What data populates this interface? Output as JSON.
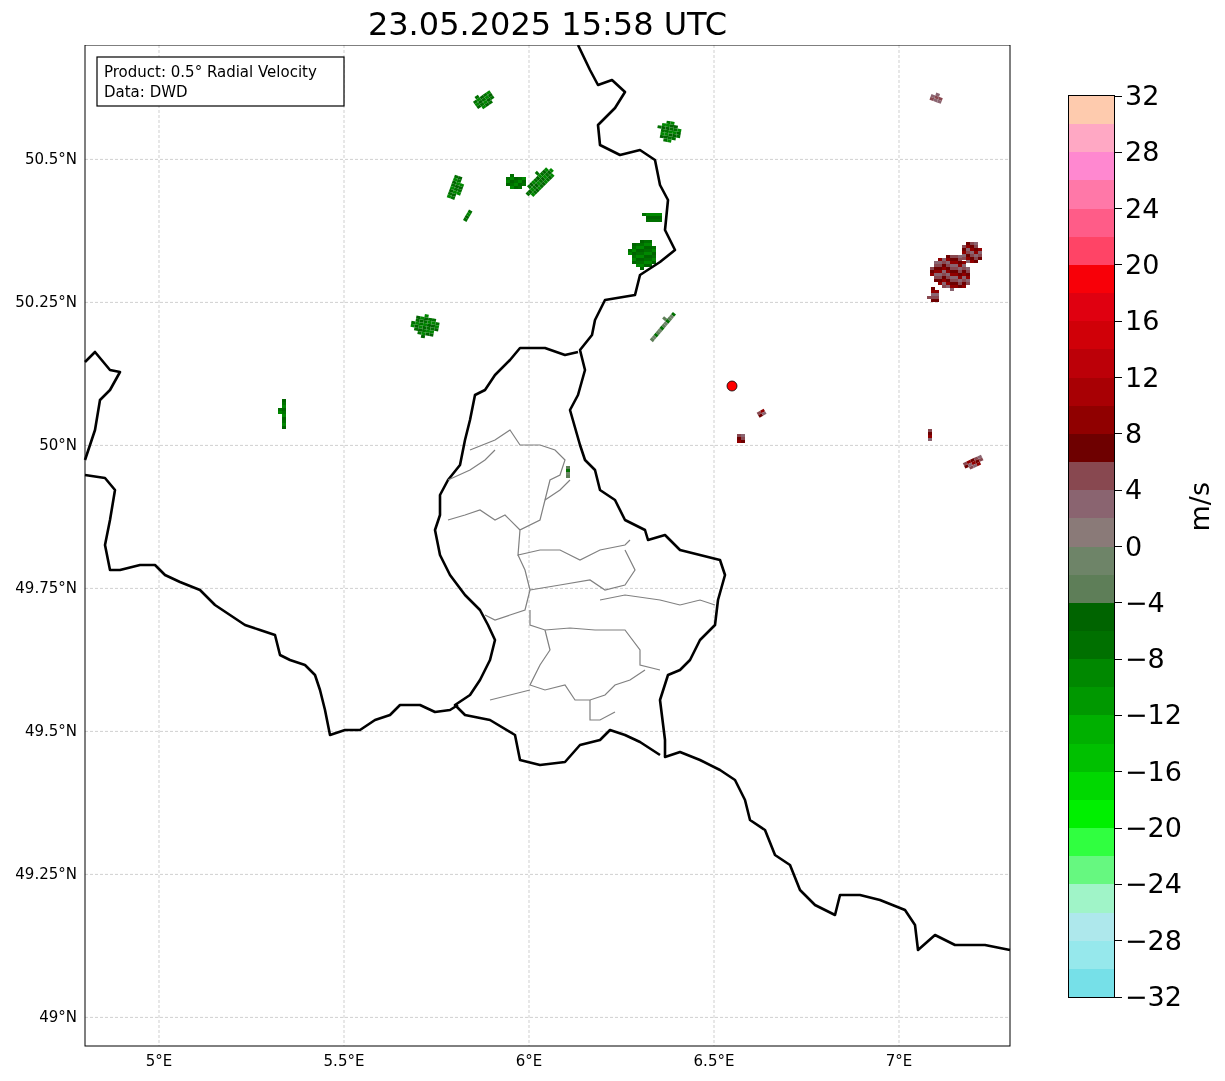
{
  "title": "23.05.2025 15:58 UTC",
  "map": {
    "yticks": [
      "50.5°N",
      "50.25°N",
      "50°N",
      "49.75°N",
      "49.5°N",
      "49.25°N",
      "49°N"
    ],
    "xticks": [
      "5°E",
      "5.5°E",
      "6°E",
      "6.5°E",
      "7°E"
    ],
    "info_box": {
      "lines": [
        "Product: 0.5° Radial Velocity",
        "Data: DWD"
      ]
    }
  },
  "colorbar": {
    "label": "m/s",
    "segments": [
      {
        "color": "#fecbae"
      },
      {
        "color": "#ffa8c4"
      },
      {
        "color": "#ff88d0"
      },
      {
        "color": "#ff78a8"
      },
      {
        "color": "#ff5c88"
      },
      {
        "color": "#ff4466"
      },
      {
        "color": "#f80008"
      },
      {
        "color": "#e00010"
      },
      {
        "color": "#d00008"
      },
      {
        "color": "#bc0008"
      },
      {
        "color": "#a80004"
      },
      {
        "color": "#900000"
      },
      {
        "color": "#6e0000"
      },
      {
        "color": "#884850"
      },
      {
        "color": "#8a6470"
      },
      {
        "color": "#8a7a78"
      },
      {
        "color": "#6e8468"
      },
      {
        "color": "#5e7e58"
      },
      {
        "color": "#006400"
      },
      {
        "color": "#007000"
      },
      {
        "color": "#008800"
      },
      {
        "color": "#009800"
      },
      {
        "color": "#00b000"
      },
      {
        "color": "#00c000"
      },
      {
        "color": "#00d800"
      },
      {
        "color": "#00f000"
      },
      {
        "color": "#30ff40"
      },
      {
        "color": "#66f880"
      },
      {
        "color": "#a0f4c8"
      },
      {
        "color": "#aee8ec"
      },
      {
        "color": "#96e8ec"
      },
      {
        "color": "#76e0e8"
      }
    ],
    "ticks": [
      "32",
      "28",
      "24",
      "20",
      "16",
      "12",
      "8",
      "4",
      "0",
      "−4",
      "−8",
      "−12",
      "−16",
      "−20",
      "−24",
      "−28",
      "−32"
    ]
  }
}
